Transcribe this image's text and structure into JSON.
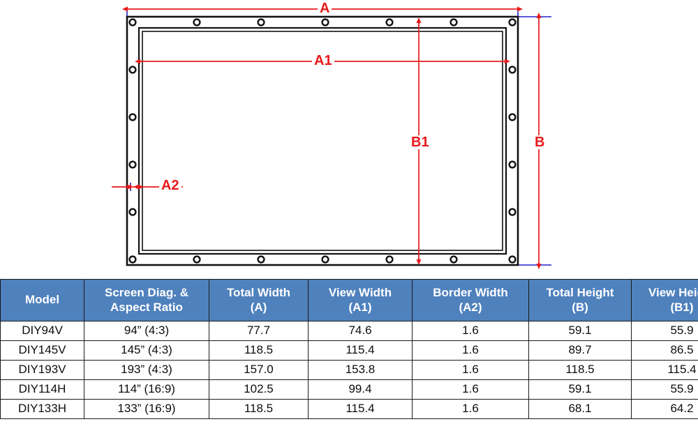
{
  "diagram": {
    "title": "projector-screen-dimension-diagram",
    "colors": {
      "dimension_line": "#e8191a",
      "extension_line": "#2222cc",
      "frame_outline": "#111111",
      "header_blue": "#4f81bd"
    },
    "labels": {
      "total_width": "A",
      "view_width": "A1",
      "border_width": "A2",
      "total_height": "B",
      "view_height": "B1"
    },
    "grommets": {
      "top_count": 7,
      "bottom_count": 7,
      "left_count": 6,
      "right_count": 6
    }
  },
  "table": {
    "columns": [
      {
        "line1": "Model",
        "line2": ""
      },
      {
        "line1": "Screen Diag. &",
        "line2": "Aspect Ratio"
      },
      {
        "line1": "Total Width",
        "line2": "(A)"
      },
      {
        "line1": "View Width",
        "line2": "(A1)"
      },
      {
        "line1": "Border Width",
        "line2": "(A2)"
      },
      {
        "line1": "Total Height",
        "line2": "(B)"
      },
      {
        "line1": "View Height",
        "line2": "(B1)"
      }
    ],
    "rows": [
      {
        "model": "DIY94V",
        "diag": "94” (4:3)",
        "total_width": "77.7",
        "view_width": "74.6",
        "border_width": "1.6",
        "total_height": "59.1",
        "view_height": "55.9"
      },
      {
        "model": "DIY145V",
        "diag": "145” (4:3)",
        "total_width": "118.5",
        "view_width": "115.4",
        "border_width": "1.6",
        "total_height": "89.7",
        "view_height": "86.5"
      },
      {
        "model": "DIY193V",
        "diag": "193” (4:3)",
        "total_width": "157.0",
        "view_width": "153.8",
        "border_width": "1.6",
        "total_height": "118.5",
        "view_height": "115.4"
      },
      {
        "model": "DIY114H",
        "diag": "114” (16:9)",
        "total_width": "102.5",
        "view_width": "99.4",
        "border_width": "1.6",
        "total_height": "59.1",
        "view_height": "55.9"
      },
      {
        "model": "DIY133H",
        "diag": "133” (16:9)",
        "total_width": "118.5",
        "view_width": "115.4",
        "border_width": "1.6",
        "total_height": "68.1",
        "view_height": "64.2"
      }
    ]
  }
}
